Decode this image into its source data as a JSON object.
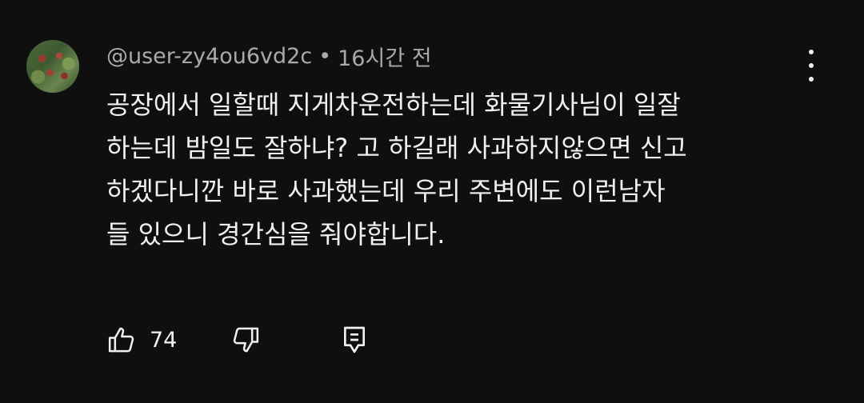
{
  "comment": {
    "author": "@user-zy4ou6vd2c",
    "separator": "•",
    "time": "16시간 전",
    "text_lines": [
      "공장에서 일할때 지게차운전하는데 화물기사님이 일잘",
      "하는데 밤일도 잘하냐? 고 하길래 사과하지않으면 신고",
      "하겠다니깐 바로 사과했는데 우리 주변에도 이런남자",
      "들 있으니 경간심을 줘야합니다."
    ],
    "like_count": "74"
  },
  "icons": {
    "avatar": "avatar-image",
    "menu": "more-vertical-icon",
    "like": "thumbs-up-icon",
    "dislike": "thumbs-down-icon",
    "reply": "comment-reply-icon"
  },
  "colors": {
    "background": "#0f0f0f",
    "text": "#f1f1f1",
    "meta": "#aaaaaa"
  }
}
